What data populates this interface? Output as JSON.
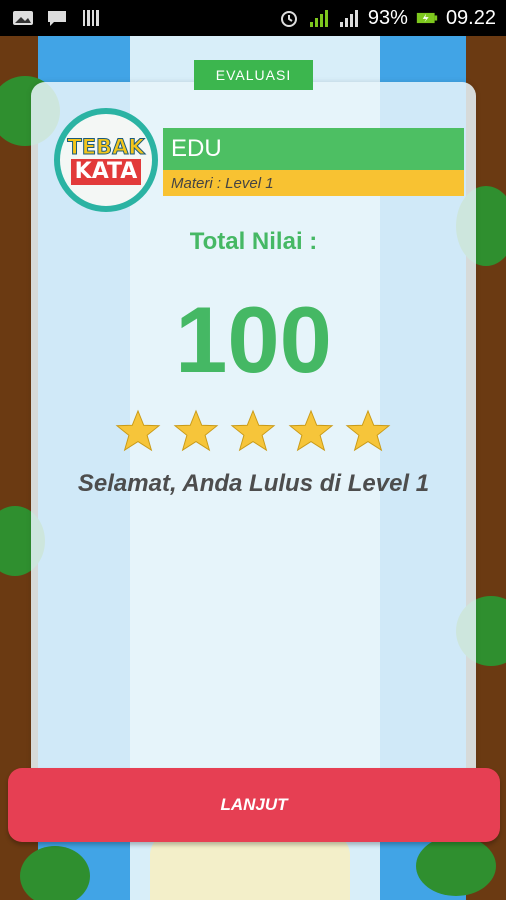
{
  "status_bar": {
    "battery_percent": "93%",
    "time": "09.22",
    "icons": [
      "gallery-icon",
      "chat-icon",
      "barcode-icon",
      "alarm-icon",
      "signal-1-icon",
      "signal-2-icon",
      "battery-icon"
    ]
  },
  "header": {
    "tab_label": "EVALUASI",
    "logo_line1": "TEBAK",
    "logo_line2": "KATA",
    "category": "EDU",
    "materi": "Materi : Level 1"
  },
  "result": {
    "total_label": "Total Nilai :",
    "score": "100",
    "stars_filled": 5,
    "stars_total": 5,
    "message": "Selamat, Anda Lulus di Level 1"
  },
  "actions": {
    "continue_label": "LANJUT"
  },
  "colors": {
    "green": "#45b864",
    "yellow": "#f8c232",
    "red_button": "#e63f53",
    "star": "#f6c53a"
  }
}
